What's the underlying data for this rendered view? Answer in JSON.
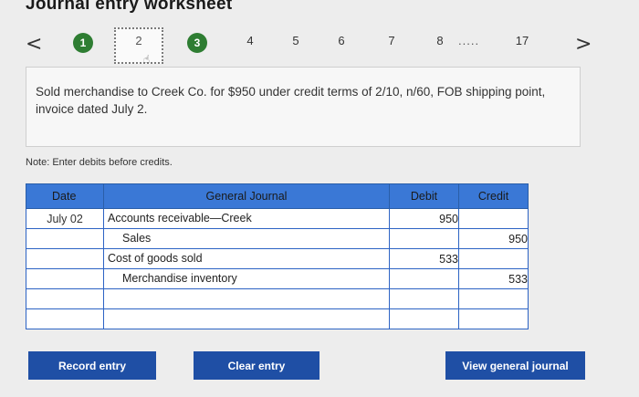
{
  "title": "Journal entry worksheet",
  "steps": {
    "prev_arrow": "<",
    "next_arrow": ">",
    "items": [
      "1",
      "2",
      "3",
      "4",
      "5",
      "6",
      "7",
      "8"
    ],
    "ellipsis": ".....",
    "last": "17"
  },
  "problem_text": "Sold merchandise to Creek Co. for $950 under credit terms of 2/10, n/60, FOB shipping point, invoice dated July 2.",
  "note": "Note: Enter debits before credits.",
  "journal": {
    "headers": {
      "date": "Date",
      "general_journal": "General Journal",
      "debit": "Debit",
      "credit": "Credit"
    },
    "rows": [
      {
        "date": "July 02",
        "account": "Accounts receivable—Creek",
        "debit": "950",
        "credit": ""
      },
      {
        "date": "",
        "account": "Sales",
        "debit": "",
        "credit": "950"
      },
      {
        "date": "",
        "account": "Cost of goods sold",
        "debit": "533",
        "credit": ""
      },
      {
        "date": "",
        "account": "Merchandise inventory",
        "debit": "",
        "credit": "533"
      },
      {
        "date": "",
        "account": "",
        "debit": "",
        "credit": ""
      },
      {
        "date": "",
        "account": "",
        "debit": "",
        "credit": ""
      }
    ]
  },
  "buttons": {
    "record": "Record entry",
    "clear": "Clear entry",
    "view": "View general journal"
  },
  "colors": {
    "step_done": "#2e7d32",
    "header_blue": "#3a78d6",
    "button_blue": "#1f4fa5"
  }
}
